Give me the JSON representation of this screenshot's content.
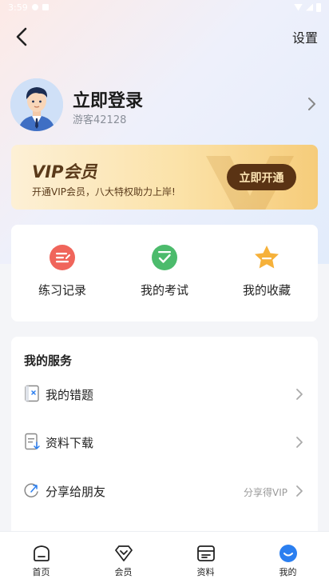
{
  "status_bar": {
    "time": "3:59"
  },
  "header": {
    "settings_label": "设置"
  },
  "profile": {
    "title": "立即登录",
    "guest_id": "游客42128"
  },
  "vip": {
    "title": "VIP会员",
    "subtitle": "开通VIP会员，八大特权助力上岸!",
    "button_label": "立即开通"
  },
  "quick_actions": [
    {
      "label": "练习记录",
      "icon": "practice-record-icon"
    },
    {
      "label": "我的考试",
      "icon": "exam-check-icon"
    },
    {
      "label": "我的收藏",
      "icon": "favorite-star-icon"
    }
  ],
  "services": {
    "title": "我的服务",
    "items": [
      {
        "label": "我的错题",
        "extra": "",
        "icon": "wrong-questions-icon"
      },
      {
        "label": "资料下载",
        "extra": "",
        "icon": "download-doc-icon"
      },
      {
        "label": "分享给朋友",
        "extra": "分享得VIP",
        "icon": "share-icon"
      }
    ]
  },
  "tab_bar": {
    "active": "我的",
    "tabs": [
      {
        "label": "首页",
        "icon": "home-icon"
      },
      {
        "label": "会员",
        "icon": "diamond-icon"
      },
      {
        "label": "资料",
        "icon": "materials-icon"
      },
      {
        "label": "我的",
        "icon": "profile-icon"
      }
    ]
  },
  "colors": {
    "vip_button_bg": "#5a3314",
    "vip_text": "#5a3a1a",
    "accent_blue": "#2b7ff0"
  }
}
